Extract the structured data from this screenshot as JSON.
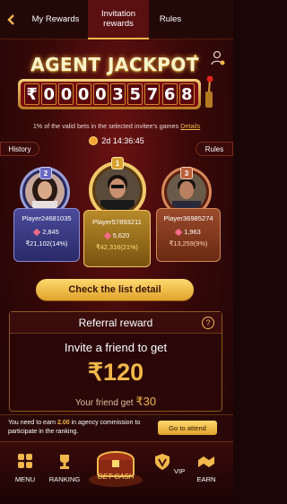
{
  "tabs": {
    "back_label": "‹",
    "rewards": "My Rewards",
    "invitation": "Invitation rewards",
    "rules": "Rules"
  },
  "jackpot": {
    "title": "AGENT JACKPOT",
    "digits": [
      "₹",
      "0",
      "0",
      "0",
      "0",
      "3",
      "5",
      "7",
      "6",
      "8"
    ],
    "note": "1% of the valid bets in the selected invitee's games",
    "details_link": "Details"
  },
  "side_buttons": {
    "history": "History",
    "rules": "Rules"
  },
  "timer": "2d 14:36:45",
  "podium": [
    {
      "rank": "2",
      "name": "Player24681035",
      "points": "2,845",
      "money": "₹21,102(14%)"
    },
    {
      "rank": "1",
      "name": "Player57893211",
      "points": "5,620",
      "money": "₹42,316(21%)"
    },
    {
      "rank": "3",
      "name": "Player36985274",
      "points": "1,963",
      "money": "₹13,259(9%)"
    }
  ],
  "check_button": "Check the list detail",
  "referral": {
    "title": "Referral reward",
    "invite_text": "Invite a friend to get",
    "amount": "₹120",
    "friend_prefix": "Your friend get",
    "friend_amount": "₹30"
  },
  "earn_bar": {
    "text_before": "You need to earn",
    "value": "2.00",
    "text_after": "in agency commission to participate in the ranking.",
    "button": "Go to attend"
  },
  "nav": {
    "menu": "MENU",
    "ranking": "RANKING",
    "cash": "GET CASH",
    "vip": "VIP",
    "earn": "EARN"
  },
  "colors": {
    "accent": "#f2b84b",
    "background": "#3a0808",
    "gold": "#ffd970"
  }
}
